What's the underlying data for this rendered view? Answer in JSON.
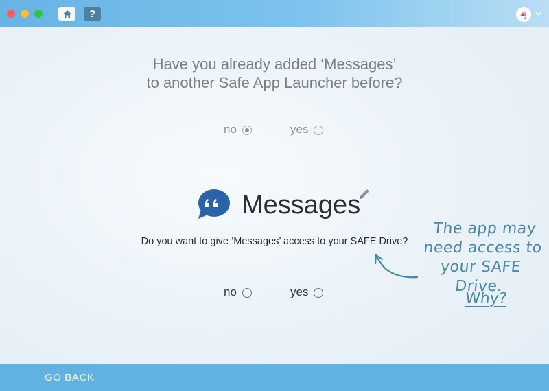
{
  "titlebar": {
    "home_icon": "home-icon",
    "help_label": "?"
  },
  "question": {
    "line1": "Have you already added ‘Messages’",
    "line2": "to another Safe App Launcher before?",
    "no_label": "no",
    "yes_label": "yes",
    "selected": "no"
  },
  "app": {
    "name": "Messages",
    "logo_icon": "quote-bubble-icon",
    "logo_color": "#2b63a8"
  },
  "access": {
    "question": "Do you want to give ‘Messages’ access to your SAFE Drive?",
    "no_label": "no",
    "yes_label": "yes",
    "selected": null
  },
  "hint": {
    "note_lines": [
      "The app may",
      "need access to",
      "your SAFE Drive."
    ],
    "why_label": "Why?"
  },
  "footer": {
    "go_back_label": "GO BACK"
  },
  "colors": {
    "accent": "#61b1e2",
    "hint": "#4a87a5"
  }
}
